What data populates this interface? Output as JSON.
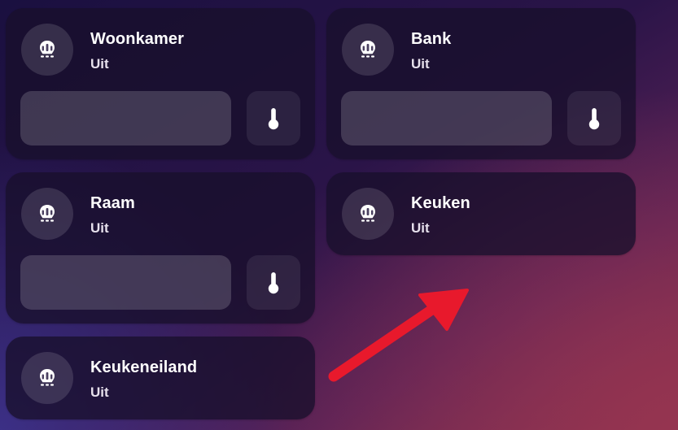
{
  "colors": {
    "card_background": "#1a1030",
    "text_primary": "#ffffff",
    "annotation_arrow": "#e8192c"
  },
  "cards": [
    {
      "title": "Woonkamer",
      "state": "Uit",
      "icon": "ceiling-light-icon",
      "has_controls": true,
      "control_icon": "thermometer-icon"
    },
    {
      "title": "Bank",
      "state": "Uit",
      "icon": "ceiling-light-icon",
      "has_controls": true,
      "control_icon": "thermometer-icon"
    },
    {
      "title": "Raam",
      "state": "Uit",
      "icon": "ceiling-light-icon",
      "has_controls": true,
      "control_icon": "thermometer-icon"
    },
    {
      "title": "Keuken",
      "state": "Uit",
      "icon": "ceiling-light-icon",
      "has_controls": false
    },
    {
      "title": "Keukeneiland",
      "state": "Uit",
      "icon": "ceiling-light-icon",
      "has_controls": false
    }
  ],
  "annotation": {
    "icon": "red-arrow-icon"
  }
}
